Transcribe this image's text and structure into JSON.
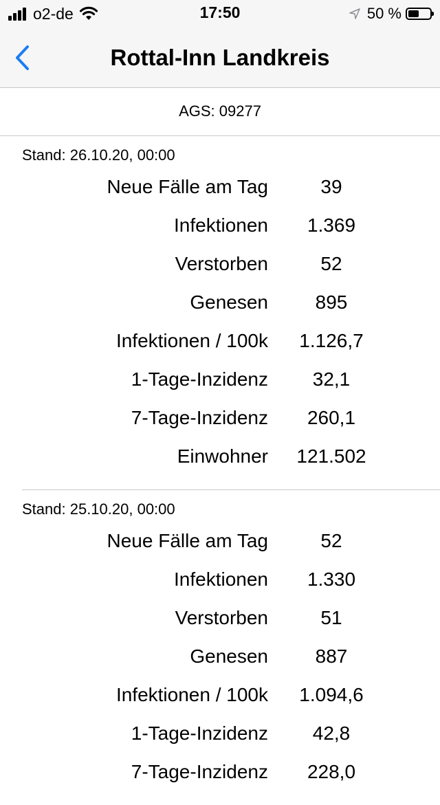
{
  "status_bar": {
    "carrier": "o2-de",
    "time": "17:50",
    "battery_percent": "50 %",
    "battery_level": 0.5,
    "icons": [
      "signal-icon",
      "wifi-icon",
      "location-icon",
      "battery-icon"
    ]
  },
  "nav": {
    "title": "Rottal-Inn Landkreis",
    "back_icon": "chevron-left-icon",
    "accent_color": "#1a7cf5"
  },
  "ags": "AGS: 09277",
  "records": [
    {
      "stand": "Stand: 26.10.20, 00:00",
      "rows": [
        {
          "label": "Neue Fälle am Tag",
          "value": "39"
        },
        {
          "label": "Infektionen",
          "value": "1.369"
        },
        {
          "label": "Verstorben",
          "value": "52"
        },
        {
          "label": "Genesen",
          "value": "895"
        },
        {
          "label": "Infektionen / 100k",
          "value": "1.126,7"
        },
        {
          "label": "1-Tage-Inzidenz",
          "value": "32,1"
        },
        {
          "label": "7-Tage-Inzidenz",
          "value": "260,1"
        },
        {
          "label": "Einwohner",
          "value": "121.502"
        }
      ]
    },
    {
      "stand": "Stand: 25.10.20, 00:00",
      "rows": [
        {
          "label": "Neue Fälle am Tag",
          "value": "52"
        },
        {
          "label": "Infektionen",
          "value": "1.330"
        },
        {
          "label": "Verstorben",
          "value": "51"
        },
        {
          "label": "Genesen",
          "value": "887"
        },
        {
          "label": "Infektionen / 100k",
          "value": "1.094,6"
        },
        {
          "label": "1-Tage-Inzidenz",
          "value": "42,8"
        },
        {
          "label": "7-Tage-Inzidenz",
          "value": "228,0"
        }
      ]
    }
  ]
}
